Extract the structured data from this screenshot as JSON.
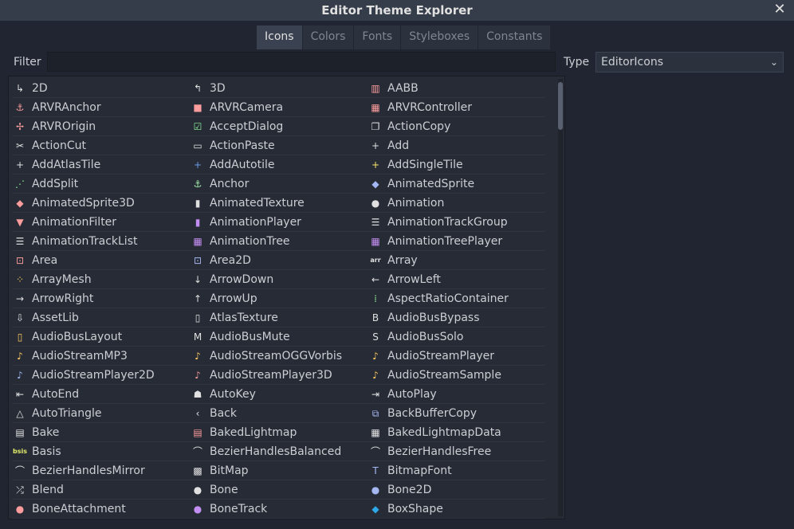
{
  "window": {
    "title": "Editor Theme Explorer"
  },
  "tabs": [
    "Icons",
    "Colors",
    "Fonts",
    "Styleboxes",
    "Constants"
  ],
  "filter": {
    "label": "Filter",
    "value": ""
  },
  "type": {
    "label": "Type",
    "value": "EditorIcons"
  },
  "icons": [
    {
      "label": "2D",
      "glyph": "↳",
      "color": "#e0e0e0"
    },
    {
      "label": "3D",
      "glyph": "↰",
      "color": "#e0e0e0"
    },
    {
      "label": "AABB",
      "glyph": "▥",
      "color": "#fc9c9c"
    },
    {
      "label": "ARVRAnchor",
      "glyph": "⚓",
      "color": "#fc9c9c"
    },
    {
      "label": "ARVRCamera",
      "glyph": "■",
      "color": "#fc9c9c"
    },
    {
      "label": "ARVRController",
      "glyph": "▦",
      "color": "#fc9c9c"
    },
    {
      "label": "ARVROrigin",
      "glyph": "✢",
      "color": "#fc9c9c"
    },
    {
      "label": "AcceptDialog",
      "glyph": "☑",
      "color": "#8eef97"
    },
    {
      "label": "ActionCopy",
      "glyph": "❐",
      "color": "#e0e0e0"
    },
    {
      "label": "ActionCut",
      "glyph": "✂",
      "color": "#e0e0e0"
    },
    {
      "label": "ActionPaste",
      "glyph": "▭",
      "color": "#e0e0e0"
    },
    {
      "label": "Add",
      "glyph": "+",
      "color": "#e0e0e0"
    },
    {
      "label": "AddAtlasTile",
      "glyph": "+",
      "color": "#e0e0e0"
    },
    {
      "label": "AddAutotile",
      "glyph": "+",
      "color": "#699ce8"
    },
    {
      "label": "AddSingleTile",
      "glyph": "+",
      "color": "#f7e86b"
    },
    {
      "label": "AddSplit",
      "glyph": "⋰",
      "color": "#8eef97"
    },
    {
      "label": "Anchor",
      "glyph": "⚓",
      "color": "#a5efac"
    },
    {
      "label": "AnimatedSprite",
      "glyph": "◆",
      "color": "#a5b7f3"
    },
    {
      "label": "AnimatedSprite3D",
      "glyph": "◆",
      "color": "#fc9c9c"
    },
    {
      "label": "AnimatedTexture",
      "glyph": "▮",
      "color": "#e0e0e0"
    },
    {
      "label": "Animation",
      "glyph": "●",
      "color": "#e0e0e0"
    },
    {
      "label": "AnimationFilter",
      "glyph": "▼",
      "color": "#fc9c9c"
    },
    {
      "label": "AnimationPlayer",
      "glyph": "▮",
      "color": "#c38ef1"
    },
    {
      "label": "AnimationTrackGroup",
      "glyph": "☰",
      "color": "#e0e0e0"
    },
    {
      "label": "AnimationTrackList",
      "glyph": "☰",
      "color": "#e0e0e0"
    },
    {
      "label": "AnimationTree",
      "glyph": "▦",
      "color": "#c38ef1"
    },
    {
      "label": "AnimationTreePlayer",
      "glyph": "▦",
      "color": "#c38ef1"
    },
    {
      "label": "Area",
      "glyph": "⊡",
      "color": "#fc9c9c"
    },
    {
      "label": "Area2D",
      "glyph": "⊡",
      "color": "#a5b7f3"
    },
    {
      "label": "Array",
      "glyph": "arr",
      "color": "#e0e0e0"
    },
    {
      "label": "ArrayMesh",
      "glyph": "⁘",
      "color": "#ffca5f"
    },
    {
      "label": "ArrowDown",
      "glyph": "↓",
      "color": "#e0e0e0"
    },
    {
      "label": "ArrowLeft",
      "glyph": "←",
      "color": "#e0e0e0"
    },
    {
      "label": "ArrowRight",
      "glyph": "→",
      "color": "#e0e0e0"
    },
    {
      "label": "ArrowUp",
      "glyph": "↑",
      "color": "#e0e0e0"
    },
    {
      "label": "AspectRatioContainer",
      "glyph": "⁞",
      "color": "#8eef97"
    },
    {
      "label": "AssetLib",
      "glyph": "⇩",
      "color": "#e0e0e0"
    },
    {
      "label": "AtlasTexture",
      "glyph": "▯",
      "color": "#e0e0e0"
    },
    {
      "label": "AudioBusBypass",
      "glyph": "B",
      "color": "#e0e0e0"
    },
    {
      "label": "AudioBusLayout",
      "glyph": "▯",
      "color": "#ffca5f"
    },
    {
      "label": "AudioBusMute",
      "glyph": "M",
      "color": "#e0e0e0"
    },
    {
      "label": "AudioBusSolo",
      "glyph": "S",
      "color": "#e0e0e0"
    },
    {
      "label": "AudioStreamMP3",
      "glyph": "♪",
      "color": "#ffca5f"
    },
    {
      "label": "AudioStreamOGGVorbis",
      "glyph": "♪",
      "color": "#ffca5f"
    },
    {
      "label": "AudioStreamPlayer",
      "glyph": "♪",
      "color": "#ffca5f"
    },
    {
      "label": "AudioStreamPlayer2D",
      "glyph": "♪",
      "color": "#a5b7f3"
    },
    {
      "label": "AudioStreamPlayer3D",
      "glyph": "♪",
      "color": "#fc9c9c"
    },
    {
      "label": "AudioStreamSample",
      "glyph": "♪",
      "color": "#ffca5f"
    },
    {
      "label": "AutoEnd",
      "glyph": "⇤",
      "color": "#e0e0e0"
    },
    {
      "label": "AutoKey",
      "glyph": "☗",
      "color": "#e0e0e0"
    },
    {
      "label": "AutoPlay",
      "glyph": "⇥",
      "color": "#e0e0e0"
    },
    {
      "label": "AutoTriangle",
      "glyph": "△",
      "color": "#e0e0e0"
    },
    {
      "label": "Back",
      "glyph": "‹",
      "color": "#e0e0e0"
    },
    {
      "label": "BackBufferCopy",
      "glyph": "⧉",
      "color": "#a5b7f3"
    },
    {
      "label": "Bake",
      "glyph": "▤",
      "color": "#e0e0e0"
    },
    {
      "label": "BakedLightmap",
      "glyph": "▤",
      "color": "#fc9c9c"
    },
    {
      "label": "BakedLightmapData",
      "glyph": "▦",
      "color": "#e0e0e0"
    },
    {
      "label": "Basis",
      "glyph": "bsis",
      "color": "#e3ec69"
    },
    {
      "label": "BezierHandlesBalanced",
      "glyph": "⌒",
      "color": "#e0e0e0"
    },
    {
      "label": "BezierHandlesFree",
      "glyph": "⌒",
      "color": "#e0e0e0"
    },
    {
      "label": "BezierHandlesMirror",
      "glyph": "⌒",
      "color": "#e0e0e0"
    },
    {
      "label": "BitMap",
      "glyph": "▩",
      "color": "#e0e0e0"
    },
    {
      "label": "BitmapFont",
      "glyph": "T",
      "color": "#a5b7f3"
    },
    {
      "label": "Blend",
      "glyph": "⤮",
      "color": "#e0e0e0"
    },
    {
      "label": "Bone",
      "glyph": "●",
      "color": "#e0e0e0"
    },
    {
      "label": "Bone2D",
      "glyph": "●",
      "color": "#a5b7f3"
    },
    {
      "label": "BoneAttachment",
      "glyph": "●",
      "color": "#fc9c9c"
    },
    {
      "label": "BoneTrack",
      "glyph": "●",
      "color": "#c38ef1"
    },
    {
      "label": "BoxShape",
      "glyph": "◆",
      "color": "#2fa8e8"
    }
  ],
  "colors": {
    "background": "#202531",
    "titlebar": "#363d4a",
    "panel": "#262b36",
    "text": "#ccced3"
  }
}
